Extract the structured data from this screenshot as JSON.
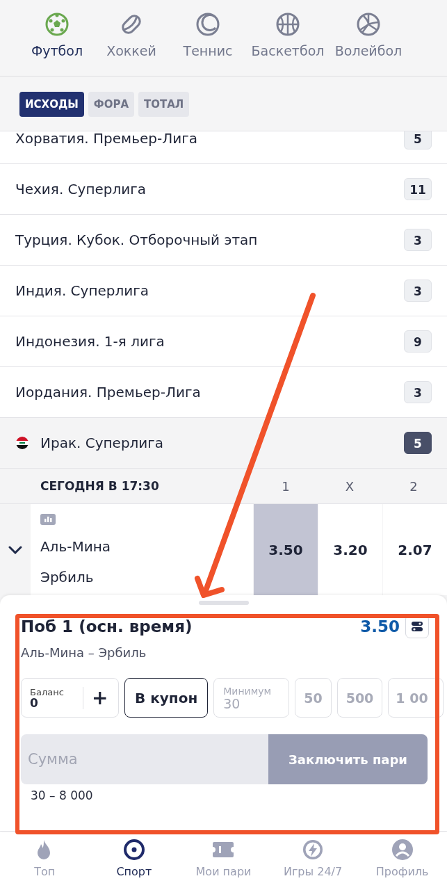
{
  "sports_tabs": [
    {
      "label": "Футбол",
      "selected": true
    },
    {
      "label": "Хоккей",
      "selected": false
    },
    {
      "label": "Теннис",
      "selected": false
    },
    {
      "label": "Баскетбол",
      "selected": false
    },
    {
      "label": "Волейбол",
      "selected": false
    }
  ],
  "market_tabs": [
    {
      "label": "ИСХОДЫ",
      "selected": true
    },
    {
      "label": "ФОРА",
      "selected": false
    },
    {
      "label": "ТОТАЛ",
      "selected": false
    }
  ],
  "leagues": [
    {
      "name": "Хорватия. Премьер-Лига",
      "count": "5",
      "expanded": false
    },
    {
      "name": "Чехия. Суперлига",
      "count": "11",
      "expanded": false
    },
    {
      "name": "Турция. Кубок. Отборочный этап",
      "count": "3",
      "expanded": false
    },
    {
      "name": "Индия. Суперлига",
      "count": "3",
      "expanded": false
    },
    {
      "name": "Индонезия. 1-я лига",
      "count": "9",
      "expanded": false
    },
    {
      "name": "Иордания. Премьер-Лига",
      "count": "3",
      "expanded": false
    },
    {
      "name": "Ирак. Суперлига",
      "count": "5",
      "expanded": true,
      "flag": true
    }
  ],
  "match_header": {
    "time": "СЕГОДНЯ В 17:30",
    "columns": [
      "1",
      "X",
      "2"
    ]
  },
  "match": {
    "teams": [
      "Аль-Мина",
      "Эрбиль"
    ],
    "odds": [
      {
        "value": "3.50",
        "selected": true
      },
      {
        "value": "3.20",
        "selected": false
      },
      {
        "value": "2.07",
        "selected": false
      }
    ]
  },
  "bet_slip": {
    "title": "Поб 1 (осн. время)",
    "odds": "3.50",
    "match": "Аль-Мина – Эрбиль",
    "balance_label": "Баланс",
    "balance_value": "0",
    "plus": "+",
    "coupon_button": "В купон",
    "min_label": "Минимум",
    "min_value": "30",
    "quick_amounts": [
      "50",
      "500",
      "1 00"
    ],
    "amount_placeholder": "Сумма",
    "submit": {
      "label": "Заключить пари",
      "disabled": true
    },
    "range": "30 – 8 000"
  },
  "bottom_nav": [
    {
      "label": "Топ",
      "selected": false
    },
    {
      "label": "Спорт",
      "selected": true
    },
    {
      "label": "Мои пари",
      "selected": false
    },
    {
      "label": "Игры 24/7",
      "selected": false
    },
    {
      "label": "Профиль",
      "selected": false
    }
  ]
}
